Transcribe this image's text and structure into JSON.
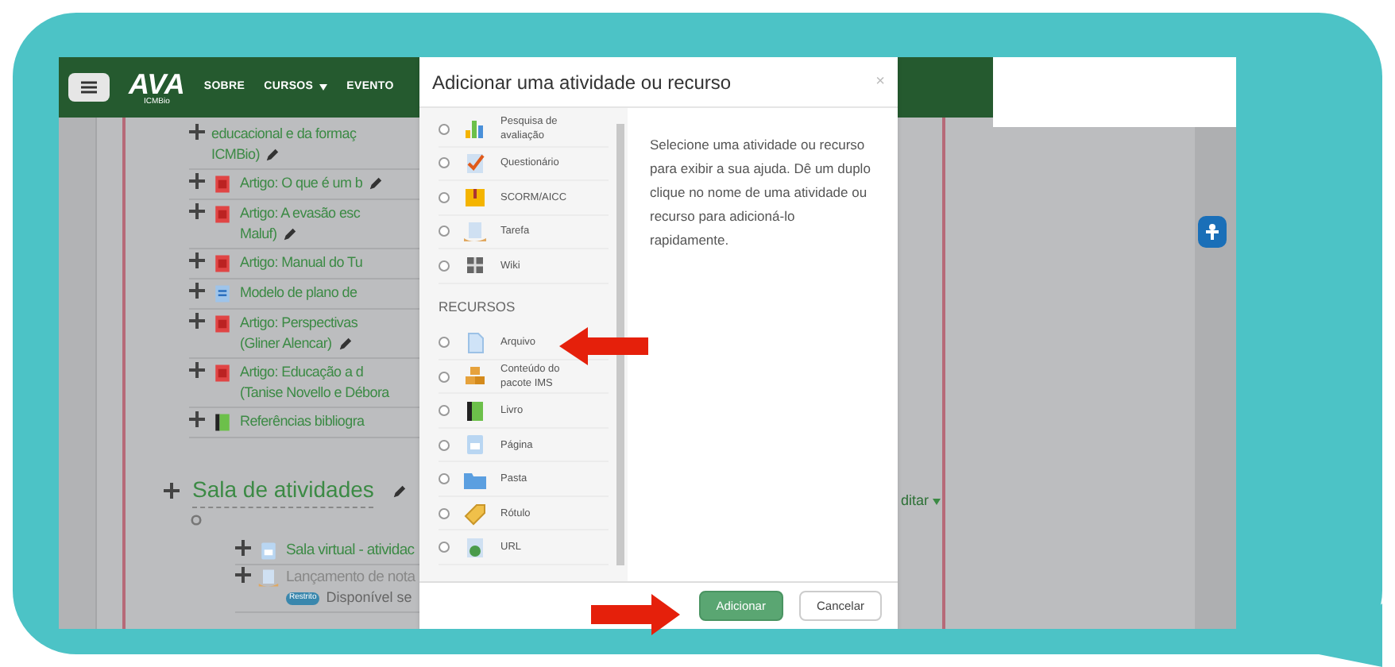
{
  "nav": {
    "logo": "AVA",
    "logo_subtitle": "ICMBio",
    "items": [
      {
        "label": "SOBRE",
        "dropdown": false
      },
      {
        "label": "CURSOS",
        "dropdown": true
      },
      {
        "label": "EVENTO",
        "dropdown": false
      }
    ]
  },
  "course_items": [
    {
      "kind": "none",
      "lines": [
        "educacional e da formaç",
        "ICMBio)"
      ],
      "editable": true
    },
    {
      "kind": "pdf",
      "lines": [
        "Artigo: O que é um b"
      ],
      "editable": true
    },
    {
      "kind": "pdf",
      "lines": [
        "Artigo: A evasão esc",
        "Maluf)"
      ],
      "editable": true
    },
    {
      "kind": "pdf",
      "lines": [
        "Artigo: Manual do Tu"
      ],
      "editable": false
    },
    {
      "kind": "doc",
      "lines": [
        "Modelo de plano de"
      ],
      "editable": false
    },
    {
      "kind": "pdf",
      "lines": [
        "Artigo: Perspectivas",
        "(Gliner Alencar)"
      ],
      "editable": true
    },
    {
      "kind": "pdf",
      "lines": [
        "Artigo: Educação a d",
        "(Tanise Novello e Débora"
      ],
      "editable": false
    },
    {
      "kind": "book",
      "lines": [
        "Referências bibliogra"
      ],
      "editable": false
    }
  ],
  "section": {
    "title": "Sala de atividades",
    "edit_menu": "ditar",
    "items": [
      {
        "kind": "page",
        "label": "Sala virtual - atividac",
        "dimmed": false
      },
      {
        "kind": "assign",
        "label": "Lançamento de nota",
        "dimmed": true,
        "badge": "Restrito",
        "note": "Disponível se"
      }
    ]
  },
  "modal": {
    "title": "Adicionar uma atividade ou recurso",
    "close": "×",
    "groups": [
      {
        "items": [
          {
            "kind": "survey",
            "label": "Pesquisa de avaliação",
            "selected": false
          },
          {
            "kind": "quiz",
            "label": "Questionário",
            "selected": false
          },
          {
            "kind": "scorm",
            "label": "SCORM/AICC",
            "selected": false
          },
          {
            "kind": "assign",
            "label": "Tarefa",
            "selected": false
          },
          {
            "kind": "wiki",
            "label": "Wiki",
            "selected": false
          }
        ]
      },
      {
        "heading": "RECURSOS",
        "items": [
          {
            "kind": "file",
            "label": "Arquivo",
            "selected": false
          },
          {
            "kind": "ims",
            "label": "Conteúdo do pacote IMS",
            "selected": false
          },
          {
            "kind": "book",
            "label": "Livro",
            "selected": false
          },
          {
            "kind": "page",
            "label": "Página",
            "selected": false
          },
          {
            "kind": "folder",
            "label": "Pasta",
            "selected": false
          },
          {
            "kind": "label",
            "label": "Rótulo",
            "selected": false
          },
          {
            "kind": "url",
            "label": "URL",
            "selected": false
          }
        ]
      }
    ],
    "help": "Selecione uma atividade ou recurso para exibir a sua ajuda. Dê um duplo clique no nome de uma atividade ou recurso para adicioná-lo rapidamente.",
    "buttons": [
      {
        "label": "Adicionar",
        "primary": true
      },
      {
        "label": "Cancelar",
        "primary": false
      }
    ]
  }
}
